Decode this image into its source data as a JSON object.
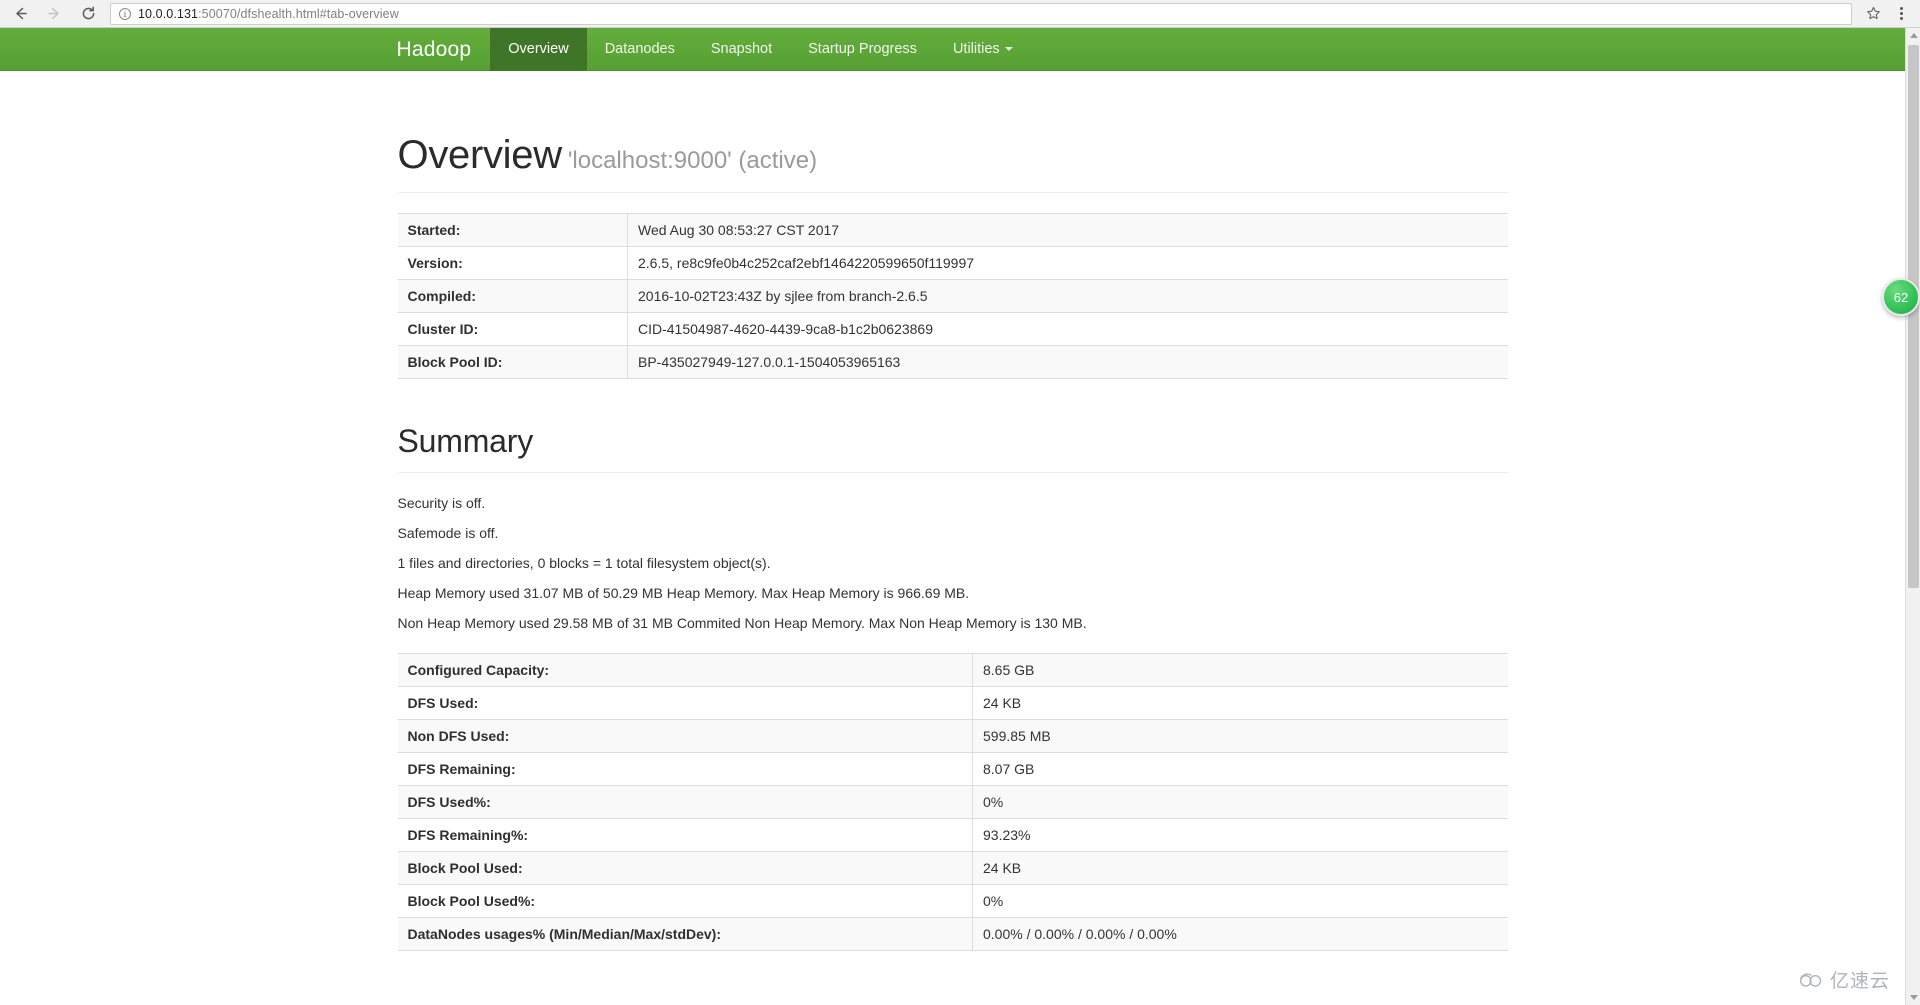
{
  "browser": {
    "back_icon": "back-arrow-icon",
    "forward_icon": "forward-arrow-icon",
    "reload_icon": "reload-icon",
    "info_icon": "ⓘ",
    "url_host": "10.0.0.131",
    "url_rest": ":50070/dfshealth.html#tab-overview",
    "url_full": "10.0.0.131:50070/dfshealth.html#tab-overview",
    "bookmark_icon": "star-icon",
    "menu_icon": "three-dot-menu-icon"
  },
  "navbar": {
    "brand": "Hadoop",
    "links": [
      {
        "label": "Overview",
        "active": true
      },
      {
        "label": "Datanodes",
        "active": false
      },
      {
        "label": "Snapshot",
        "active": false
      },
      {
        "label": "Startup Progress",
        "active": false
      },
      {
        "label": "Utilities",
        "active": false,
        "caret": true
      }
    ],
    "accent_color": "#5fa93a",
    "active_color": "#3f7527"
  },
  "overview": {
    "title": "Overview",
    "subtitle": "'localhost:9000' (active)",
    "rows": [
      {
        "key": "Started:",
        "value": "Wed Aug 30 08:53:27 CST 2017"
      },
      {
        "key": "Version:",
        "value": "2.6.5, re8c9fe0b4c252caf2ebf1464220599650f119997"
      },
      {
        "key": "Compiled:",
        "value": "2016-10-02T23:43Z by sjlee from branch-2.6.5"
      },
      {
        "key": "Cluster ID:",
        "value": "CID-41504987-4620-4439-9ca8-b1c2b0623869"
      },
      {
        "key": "Block Pool ID:",
        "value": "BP-435027949-127.0.0.1-1504053965163"
      }
    ]
  },
  "summary": {
    "title": "Summary",
    "lines": [
      "Security is off.",
      "Safemode is off.",
      "1 files and directories, 0 blocks = 1 total filesystem object(s).",
      "Heap Memory used 31.07 MB of 50.29 MB Heap Memory. Max Heap Memory is 966.69 MB.",
      "Non Heap Memory used 29.58 MB of 31 MB Commited Non Heap Memory. Max Non Heap Memory is 130 MB."
    ],
    "rows": [
      {
        "key": "Configured Capacity:",
        "value": "8.65 GB"
      },
      {
        "key": "DFS Used:",
        "value": "24 KB"
      },
      {
        "key": "Non DFS Used:",
        "value": "599.85 MB"
      },
      {
        "key": "DFS Remaining:",
        "value": "8.07 GB"
      },
      {
        "key": "DFS Used%:",
        "value": "0%"
      },
      {
        "key": "DFS Remaining%:",
        "value": "93.23%"
      },
      {
        "key": "Block Pool Used:",
        "value": "24 KB"
      },
      {
        "key": "Block Pool Used%:",
        "value": "0%"
      },
      {
        "key": "DataNodes usages% (Min/Median/Max/stdDev):",
        "value": "0.00% / 0.00% / 0.00% / 0.00%"
      }
    ]
  },
  "float_badge": {
    "label": "62"
  },
  "watermark": {
    "text": "亿速云"
  }
}
